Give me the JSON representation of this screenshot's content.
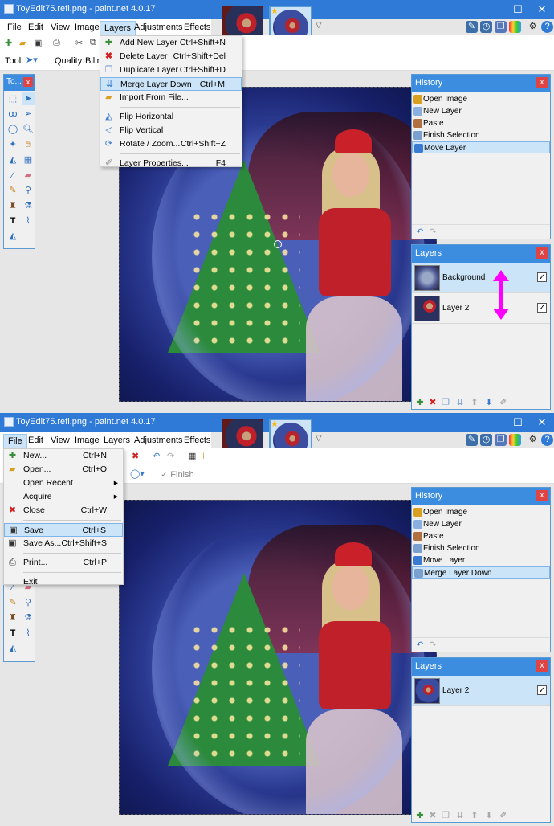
{
  "app": {
    "window_title": "ToyEdit75.refl.png - paint.net 4.0.17",
    "menus": [
      "File",
      "Edit",
      "View",
      "Image",
      "Layers",
      "Adjustments",
      "Effects"
    ],
    "window_buttons": [
      "—",
      "☐",
      "✕"
    ]
  },
  "shot1": {
    "open_menu": "Layers",
    "toolbar2": {
      "tool_label": "Tool:",
      "quality_label": "Quality:",
      "quality_value": "Bilin"
    },
    "tools_title": "To...",
    "layers_menu": [
      {
        "label": "Add New Layer",
        "shortcut": "Ctrl+Shift+N",
        "icon": "add-layer-icon"
      },
      {
        "label": "Delete Layer",
        "shortcut": "Ctrl+Shift+Del",
        "icon": "delete-layer-icon"
      },
      {
        "label": "Duplicate Layer",
        "shortcut": "Ctrl+Shift+D",
        "icon": "duplicate-layer-icon"
      },
      {
        "label": "Merge Layer Down",
        "shortcut": "Ctrl+M",
        "icon": "merge-down-icon",
        "highlighted": true
      },
      {
        "label": "Import From File...",
        "shortcut": "",
        "icon": "import-icon"
      },
      {
        "label": "Flip Horizontal",
        "shortcut": "",
        "icon": "flip-h-icon"
      },
      {
        "label": "Flip Vertical",
        "shortcut": "",
        "icon": "flip-v-icon"
      },
      {
        "label": "Rotate / Zoom...",
        "shortcut": "Ctrl+Shift+Z",
        "icon": "rotate-zoom-icon"
      },
      {
        "label": "Layer Properties...",
        "shortcut": "F4",
        "icon": "properties-icon"
      }
    ],
    "history": {
      "title": "History",
      "items": [
        "Open Image",
        "New Layer",
        "Paste",
        "Finish Selection",
        "Move Layer"
      ],
      "selected_index": 4
    },
    "layers": {
      "title": "Layers",
      "items": [
        {
          "name": "Background",
          "checked": true,
          "selected": true
        },
        {
          "name": "Layer 2",
          "checked": true,
          "selected": false
        }
      ]
    },
    "annotation_color": "#ff00ff"
  },
  "shot2": {
    "open_menu": "File",
    "toolbar2": {
      "finish_label": "Finish"
    },
    "file_menu": [
      {
        "label": "New...",
        "shortcut": "Ctrl+N",
        "icon": "new-icon",
        "submenu": false
      },
      {
        "label": "Open...",
        "shortcut": "Ctrl+O",
        "icon": "open-icon",
        "submenu": false
      },
      {
        "label": "Open Recent",
        "shortcut": "",
        "icon": "",
        "submenu": true
      },
      {
        "label": "Acquire",
        "shortcut": "",
        "icon": "",
        "submenu": true
      },
      {
        "label": "Close",
        "shortcut": "Ctrl+W",
        "icon": "close-doc-icon",
        "submenu": false
      },
      {
        "label": "Save",
        "shortcut": "Ctrl+S",
        "icon": "save-icon",
        "submenu": false,
        "highlighted": true
      },
      {
        "label": "Save As...",
        "shortcut": "Ctrl+Shift+S",
        "icon": "save-as-icon",
        "submenu": false
      },
      {
        "label": "Print...",
        "shortcut": "Ctrl+P",
        "icon": "print-icon",
        "submenu": false
      },
      {
        "label": "Exit",
        "shortcut": "",
        "icon": "",
        "submenu": false
      }
    ],
    "history": {
      "title": "History",
      "items": [
        "Open Image",
        "New Layer",
        "Paste",
        "Finish Selection",
        "Move Layer",
        "Merge Layer Down"
      ],
      "selected_index": 5
    },
    "layers": {
      "title": "Layers",
      "items": [
        {
          "name": "Layer 2",
          "checked": true,
          "selected": true
        }
      ]
    }
  },
  "colors": {
    "accent": "#3c8de0",
    "titlebar": "#2f7ad6",
    "selection": "#cce4f7",
    "close_red": "#e04343"
  }
}
